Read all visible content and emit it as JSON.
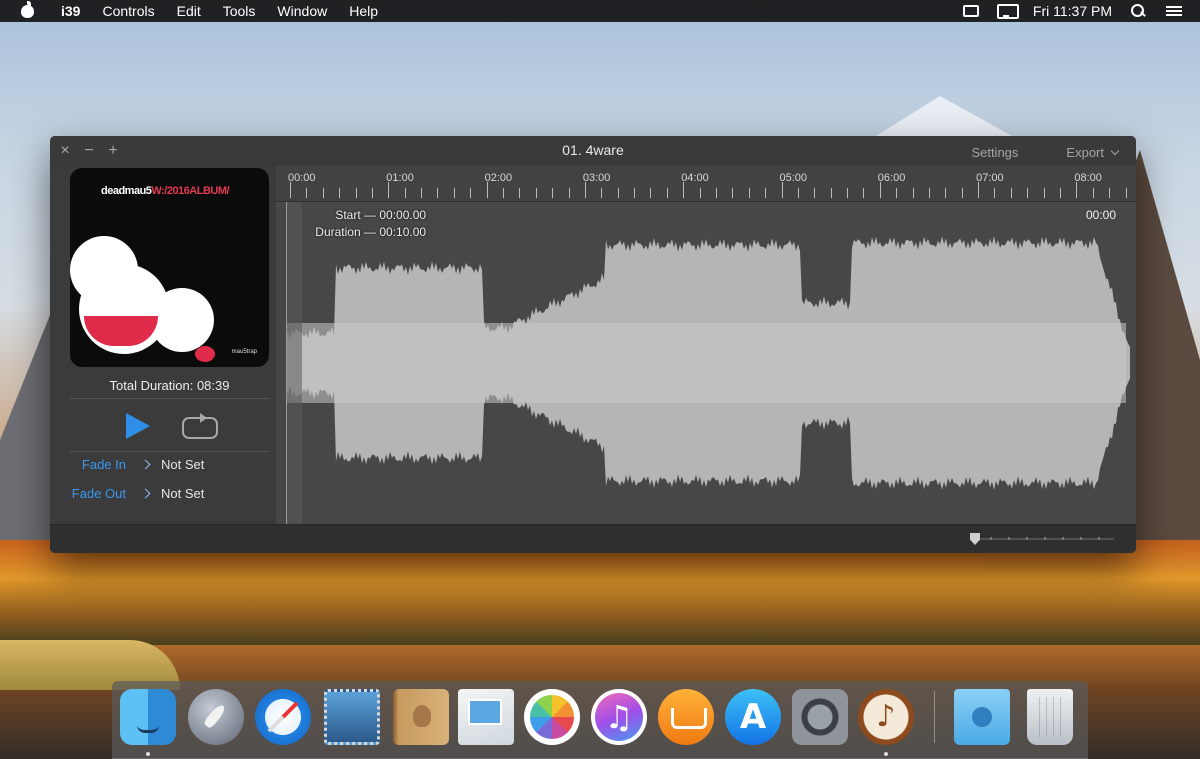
{
  "menubar": {
    "app_name": "i39",
    "items": [
      "Controls",
      "Edit",
      "Tools",
      "Window",
      "Help"
    ],
    "clock": "Fri 11:37 PM"
  },
  "window": {
    "title": "01. 4ware",
    "settings_label": "Settings",
    "export_label": "Export",
    "controls": {
      "close": "×",
      "minimize": "−",
      "zoom": "+"
    }
  },
  "left_panel": {
    "album_art": {
      "artist_text": "deadmau5",
      "album_text": "W:/2016ALBUM/",
      "signature": "mau5trap"
    },
    "total_duration_label": "Total Duration: 08:39",
    "fade_in": {
      "label": "Fade In",
      "value": "Not Set"
    },
    "fade_out": {
      "label": "Fade Out",
      "value": "Not Set"
    }
  },
  "waveform": {
    "ruler_labels": [
      "00:00",
      "01:00",
      "02:00",
      "03:00",
      "04:00",
      "05:00",
      "06:00",
      "07:00",
      "08:00"
    ],
    "start_label": "Start —",
    "start_value": "00:00.00",
    "duration_label": "Duration —",
    "duration_value": "00:10.00",
    "current_time": "00:00"
  },
  "dock": {
    "apps": [
      {
        "name": "finder-icon",
        "running": true
      },
      {
        "name": "launchpad-icon",
        "running": false
      },
      {
        "name": "safari-icon",
        "running": false
      },
      {
        "name": "mail-icon",
        "running": false
      },
      {
        "name": "contacts-icon",
        "running": false
      },
      {
        "name": "preview-icon",
        "running": false
      },
      {
        "name": "photos-icon",
        "running": false
      },
      {
        "name": "itunes-icon",
        "running": false
      },
      {
        "name": "ibooks-icon",
        "running": false
      },
      {
        "name": "app-store-icon",
        "running": false
      },
      {
        "name": "system-preferences-icon",
        "running": false
      },
      {
        "name": "i39-icon",
        "running": true
      },
      {
        "name": "downloads-folder-icon",
        "running": false
      },
      {
        "name": "trash-icon",
        "running": false
      }
    ]
  },
  "colors": {
    "accent_blue": "#2f8ee6",
    "fade_label_blue": "#3c98f0",
    "window_bg": "#3b3b3b",
    "waveform_fill": "#b5b5b5"
  }
}
